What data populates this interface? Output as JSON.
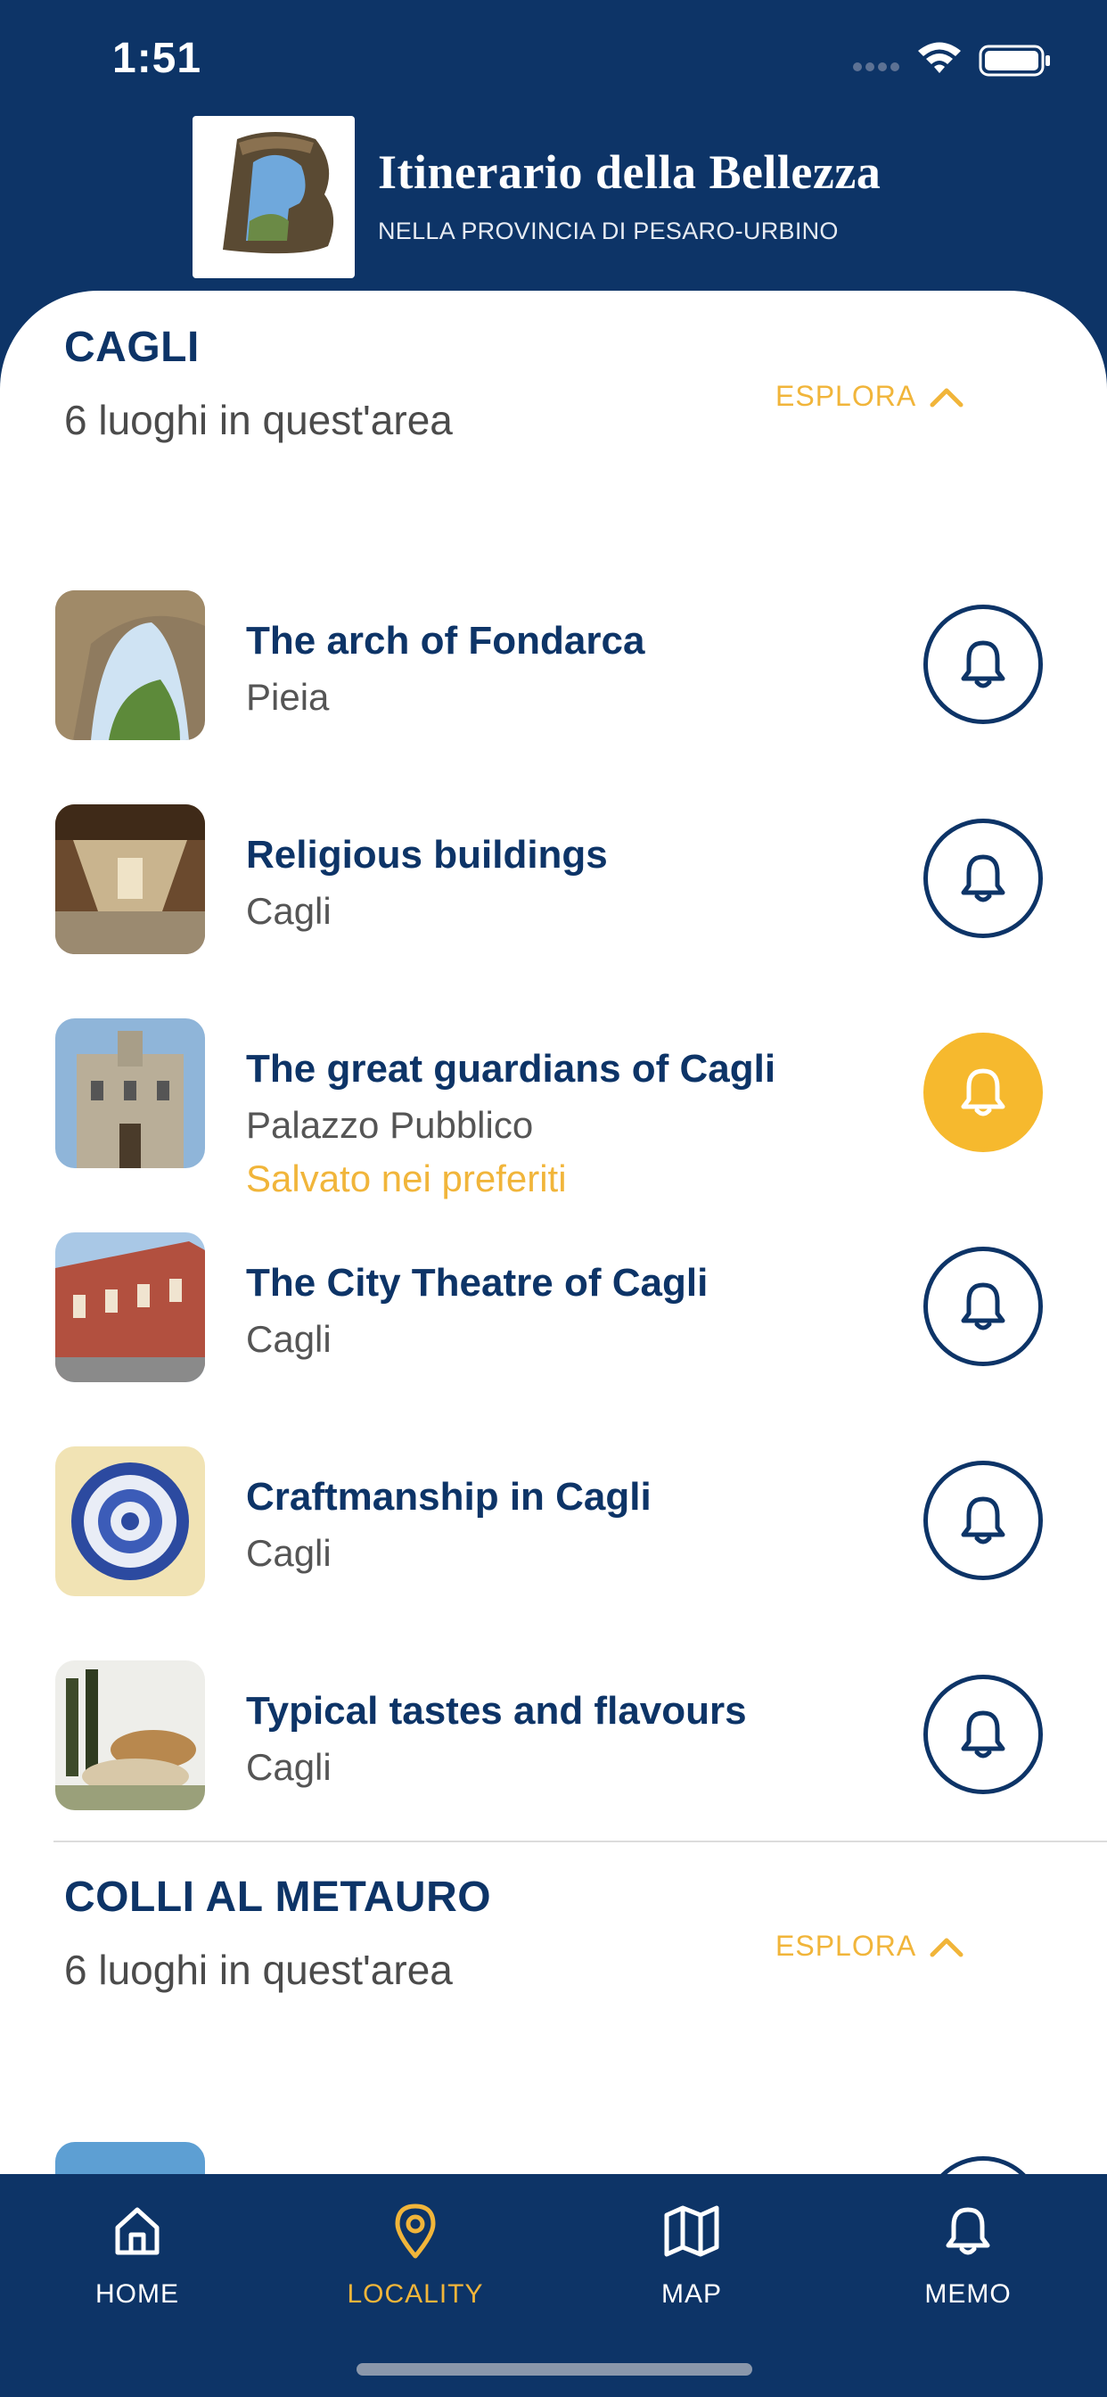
{
  "status_bar": {
    "time": "1:51"
  },
  "header": {
    "title": "Itinerario della Bellezza",
    "subtitle": "NELLA PROVINCIA DI PESARO-URBINO",
    "logo_icon": "arch-logo-icon"
  },
  "colors": {
    "navy": "#0d3467",
    "gold": "#f1b53a",
    "text_gray": "#555555"
  },
  "sections": [
    {
      "title": "CAGLI",
      "count_text": "6 luoghi in quest'area",
      "explore_label": "ESPLORA",
      "items": [
        {
          "title": "The arch of Fondarca",
          "subtitle": "Pieia",
          "note": "",
          "saved": false
        },
        {
          "title": "Religious buildings",
          "subtitle": "Cagli",
          "note": "",
          "saved": false
        },
        {
          "title": "The great guardians of Cagli",
          "subtitle": "Palazzo Pubblico",
          "note": "Salvato nei preferiti",
          "saved": true
        },
        {
          "title": "The City Theatre of Cagli",
          "subtitle": "Cagli",
          "note": "",
          "saved": false
        },
        {
          "title": "Craftmanship in Cagli",
          "subtitle": "Cagli",
          "note": "",
          "saved": false
        },
        {
          "title": "Typical tastes and flavours",
          "subtitle": "Cagli",
          "note": "",
          "saved": false
        }
      ]
    },
    {
      "title": "COLLI AL METAURO",
      "count_text": "6 luoghi in quest'area",
      "explore_label": "ESPLORA",
      "items": []
    }
  ],
  "tab_bar": {
    "tabs": [
      {
        "label": "HOME",
        "icon": "home-icon",
        "active": false
      },
      {
        "label": "LOCALITY",
        "icon": "location-pin-icon",
        "active": true
      },
      {
        "label": "MAP",
        "icon": "map-icon",
        "active": false
      },
      {
        "label": "MEMO",
        "icon": "bell-icon",
        "active": false
      }
    ]
  }
}
